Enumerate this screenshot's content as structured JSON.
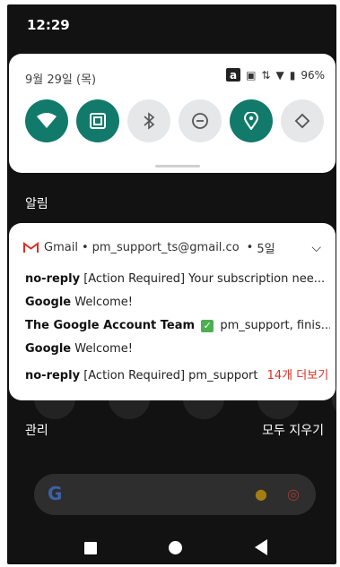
{
  "status_bar": {
    "time": "12:29"
  },
  "quick_settings": {
    "date": "9월 29일 (목)",
    "battery": "96%",
    "a_label": "a",
    "tiles": [
      {
        "name": "wifi-tile",
        "icon": "wifi-icon",
        "on": true
      },
      {
        "name": "nfc-tile",
        "icon": "nfc-icon",
        "on": true
      },
      {
        "name": "bluetooth-tile",
        "icon": "bluetooth-icon",
        "on": false
      },
      {
        "name": "dnd-tile",
        "icon": "do-not-disturb-icon",
        "on": false
      },
      {
        "name": "location-tile",
        "icon": "location-icon",
        "on": true
      },
      {
        "name": "autorotate-tile",
        "icon": "autorotate-icon",
        "on": false
      }
    ]
  },
  "notifications_label": "알림",
  "notification": {
    "app": "Gmail",
    "account": "pm_support_ts@gmail.co",
    "dot": "•",
    "time": "5일",
    "rows": [
      {
        "sender": "no-reply",
        "text": "[Action Required] Your subscription nee..."
      },
      {
        "sender": "Google",
        "text": "Welcome!"
      },
      {
        "sender": "The Google Account Team",
        "text": "pm_support, finis..."
      },
      {
        "sender": "Google",
        "text": "Welcome!"
      },
      {
        "sender": "no-reply",
        "text": "[Action Required] pm_support",
        "more": "14개 더보기"
      }
    ]
  },
  "manage_label": "관리",
  "clear_all_label": "모두 지우기",
  "colors": {
    "tile_on": "#117a6b",
    "tile_off": "#e5e7e9",
    "more_red": "#d93025"
  }
}
